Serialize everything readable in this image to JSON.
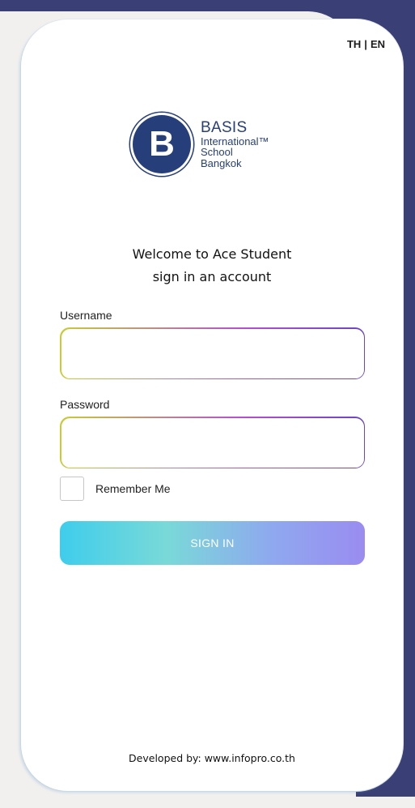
{
  "language": {
    "th": "TH",
    "separator": "|",
    "en": "EN"
  },
  "logo": {
    "letter": "B",
    "line1": "BASIS",
    "line2": "International™",
    "line3": "School",
    "line4": "Bangkok"
  },
  "welcome": {
    "line1": "Welcome to Ace Student",
    "line2": "sign in an account"
  },
  "form": {
    "username_label": "Username",
    "username_value": "",
    "password_label": "Password",
    "password_value": "",
    "remember_label": "Remember Me",
    "signin_label": "SIGN IN"
  },
  "footer": {
    "text": "Developed by: www.infopro.co.th"
  },
  "colors": {
    "navy_background": "#3a4076",
    "logo_blue": "#263e79",
    "button_gradient_start": "#3fcdec",
    "button_gradient_end": "#9a8cf0"
  }
}
